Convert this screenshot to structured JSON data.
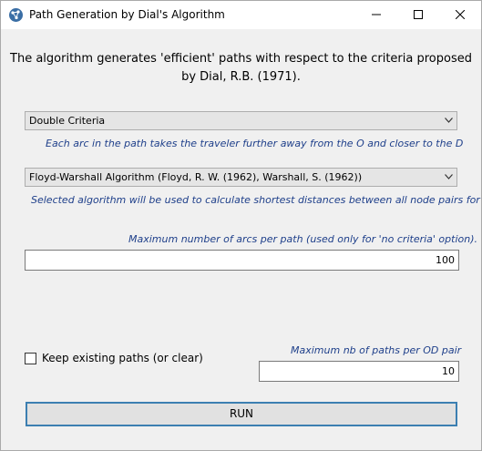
{
  "window": {
    "title": "Path Generation by Dial's Algorithm",
    "app_icon": "network-icon",
    "controls": [
      "minimize-icon",
      "maximize-icon",
      "close-icon"
    ]
  },
  "headline": "The algorithm generates 'efficient' paths with respect to the criteria proposed by Dial, R.B. (1971).",
  "criteria": {
    "selected": "Double Criteria",
    "hint": "Each arc in the path takes the traveler further away from the O and closer to the D"
  },
  "algorithm": {
    "selected": "Floyd-Warshall Algorithm (Floyd, R. W. (1962), Warshall, S. (1962))",
    "hint": "Selected algorithm will be used to calculate shortest distances between all node pairs for"
  },
  "max_arcs": {
    "label": "Maximum number of arcs per path (used only for 'no criteria' option).",
    "value": "100"
  },
  "keep_paths": {
    "label": "Keep existing paths (or clear)",
    "checked": false
  },
  "max_paths": {
    "label": "Maximum nb of paths per OD pair",
    "value": "10"
  },
  "run_button": "RUN",
  "colors": {
    "hint_text": "#1e3f8a",
    "run_border": "#3c7fb1",
    "background": "#f0f0f0"
  }
}
